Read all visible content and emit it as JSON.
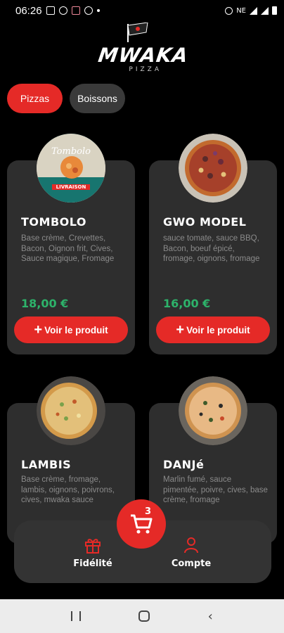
{
  "status_bar": {
    "time": "06:26",
    "right_text": "NE"
  },
  "logo": {
    "brand": "MWAKA",
    "sub": "PIZZA"
  },
  "tabs": [
    {
      "label": "Pizzas",
      "active": true
    },
    {
      "label": "Boissons",
      "active": false
    }
  ],
  "products": [
    {
      "name": "TOMBOLO",
      "description": "Base crème, Crevettes, Bacon, Oignon frit, Cives, Sauce magique, Fromage",
      "price": "18,00 €",
      "cta": "Voir le produit",
      "photo_text": "Tombolo",
      "photo_caption": "LIVRAISON"
    },
    {
      "name": "GWO MODEL",
      "description": "sauce tomate, sauce BBQ, Bacon, boeuf épicé, fromage, oignons, fromage",
      "price": "16,00 €",
      "cta": "Voir le produit"
    },
    {
      "name": "LAMBIS",
      "description": "Base crème, fromage, lambis, oignons, poivrons, cives, mwaka sauce"
    },
    {
      "name": "DANJé",
      "description": "Marlin fumé, sauce pimentée, poivre, cives, base crème, fromage"
    }
  ],
  "bottom_nav": {
    "cart_count": "3",
    "fidelite_label": "Fidélité",
    "compte_label": "Compte"
  },
  "colors": {
    "accent": "#e52a27",
    "card": "#2e2e2e",
    "price": "#2db36a",
    "background": "#000000"
  }
}
